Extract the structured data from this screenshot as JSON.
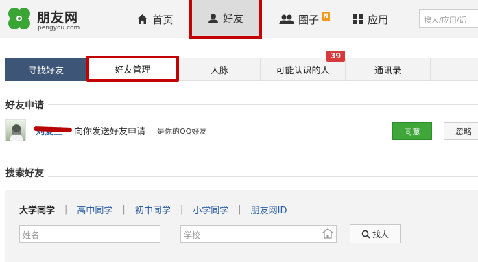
{
  "brand": {
    "name": "朋友网",
    "domain": "pengyou.com",
    "color": "#3aa535"
  },
  "nav": {
    "home": "首页",
    "friends": "好友",
    "circles": "圈子",
    "circles_badge": "N",
    "apps": "应用",
    "search_placeholder": "搜人/应用/话"
  },
  "subtabs": {
    "find": "寻找好友",
    "manage": "好友管理",
    "network": "人脉",
    "maybe_know": "可能认识的人",
    "maybe_know_count": "39",
    "contacts": "通讯录"
  },
  "requests": {
    "title": "好友申请",
    "item": {
      "name": "刘爱兰",
      "message": "向你发送好友申请",
      "note": "是你的QQ好友",
      "agree": "同意",
      "ignore": "忽略"
    }
  },
  "search": {
    "title": "搜索好友",
    "tabs": [
      "大学同学",
      "高中同学",
      "初中同学",
      "小学同学",
      "朋友网ID"
    ],
    "separator": "|",
    "name_placeholder": "姓名",
    "school_placeholder": "学校",
    "find_button": "找人"
  },
  "colors": {
    "active_tab": "#3d5577",
    "link": "#2a5ea4",
    "agree": "#3fa63a",
    "highlight": "#c40000"
  }
}
